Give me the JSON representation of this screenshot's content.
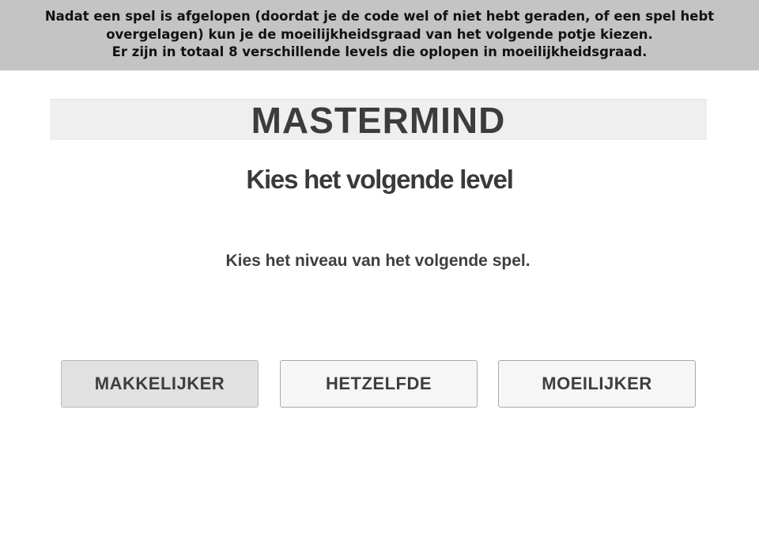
{
  "caption": {
    "lines": [
      "Nadat een spel is afgelopen (doordat je de code wel of niet hebt geraden, of een spel hebt",
      "overgelagen) kun je de moeilijkheidsgraad van het volgende potje kiezen.",
      "Er zijn in totaal 8 verschillende levels die oplopen in moeilijkheidsgraad."
    ]
  },
  "header": {
    "title": "MASTERMIND"
  },
  "screen": {
    "heading": "Kies het volgende level",
    "instruction": "Kies het niveau van het volgende spel."
  },
  "level_buttons": [
    {
      "label": "MAKKELIJKER",
      "state": "pressed"
    },
    {
      "label": "HETZELFDE",
      "state": "normal"
    },
    {
      "label": "MOEILIJKER",
      "state": "normal"
    }
  ],
  "colors": {
    "caption_background": "#c4c4c4",
    "header_background": "#efefef",
    "button_background": "#f6f6f6",
    "button_pressed_background": "#e1e1e1",
    "text": "#3c3c3c"
  }
}
